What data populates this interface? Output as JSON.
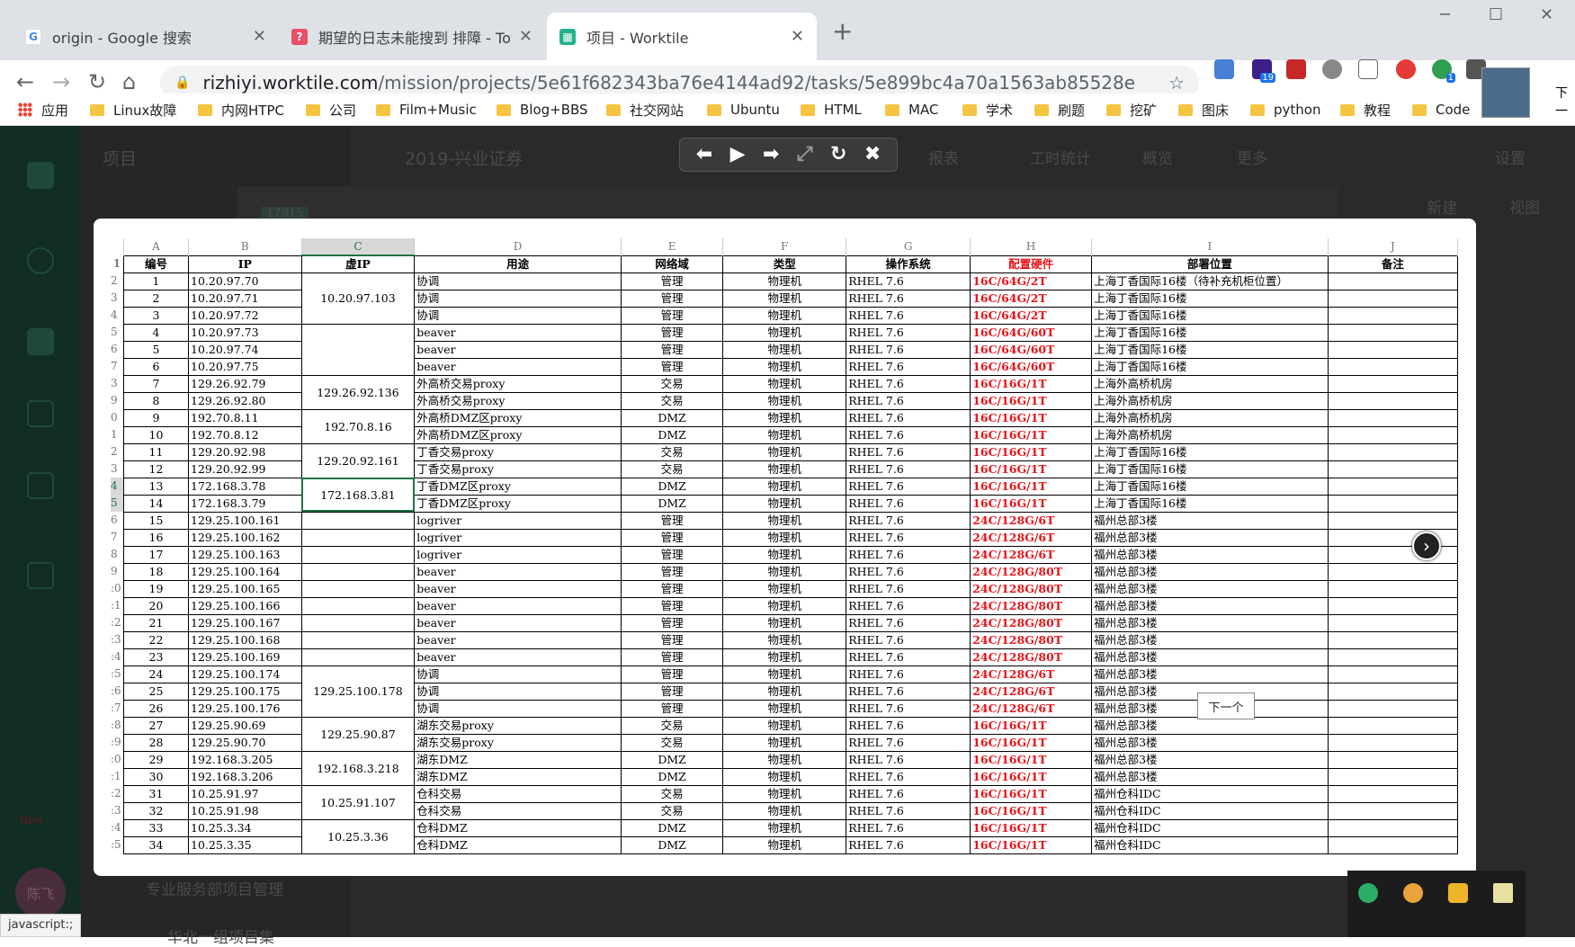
{
  "browser": {
    "tabs": [
      {
        "title": "origin - Google 搜索",
        "icon": "google-icon",
        "active": false
      },
      {
        "title": "期望的日志未能搜到 排障 - Tow",
        "icon": "tower-icon",
        "active": false
      },
      {
        "title": "项目 - Worktile",
        "icon": "worktile-icon",
        "active": true
      }
    ],
    "url_host": "rizhiyi.worktile.com",
    "url_path": "/mission/projects/5e61f682343ba76e4144ad92/tasks/5e899bc4a70a1563ab85528e",
    "extension_badges": [
      "19",
      "1"
    ],
    "bookmarks": [
      "应用",
      "Linux故障",
      "内网HTPC",
      "公司",
      "Film+Music",
      "Blog+BBS",
      "社交网站",
      "Ubuntu",
      "HTML",
      "MAC",
      "学术",
      "刷题",
      "挖矿",
      "图床",
      "python",
      "教程",
      "Code"
    ],
    "edge_text": "下一"
  },
  "app": {
    "sidebar_project_title": "项目",
    "project_name": "2019-兴业证券",
    "tab_count": "17915",
    "nav_items": [
      "报表",
      "工时统计",
      "概览",
      "更多"
    ],
    "settings": "设置",
    "new_button": "新建",
    "view_button": "视图",
    "new_badge": "New",
    "avatar_text": "陈飞",
    "group_name": "专业服务部项目管理",
    "sub_group": "华北一组项目集"
  },
  "viewer": {
    "tooltip": "下一个"
  },
  "sheet": {
    "columns": [
      "A",
      "B",
      "C",
      "D",
      "E",
      "F",
      "G",
      "H",
      "I",
      "J"
    ],
    "selected_column": "C",
    "row_numbers": [
      "1",
      "2",
      "3",
      "4",
      "5",
      "6",
      "7",
      "3",
      "9",
      "0",
      "1",
      "2",
      "3",
      "4",
      "5",
      "6",
      "7",
      "8",
      "9",
      ":0",
      ":1",
      ":2",
      ":3",
      ":4",
      ":5",
      ":6",
      ":7",
      ":8",
      ":9",
      ":0",
      ":1",
      ":2",
      ":3",
      ":4",
      ":5"
    ],
    "headers": [
      "编号",
      "IP",
      "虚IP",
      "用途",
      "网络域",
      "类型",
      "操作系统",
      "配置硬件",
      "部署位置",
      "备注"
    ],
    "rows": [
      [
        "1",
        "10.20.97.70",
        "协调",
        "管理",
        "物理机",
        "RHEL 7.6",
        "16C/64G/2T",
        "上海丁香国际16楼（待补充机柜位置）"
      ],
      [
        "2",
        "10.20.97.71",
        "协调",
        "管理",
        "物理机",
        "RHEL 7.6",
        "16C/64G/2T",
        "上海丁香国际16楼"
      ],
      [
        "3",
        "10.20.97.72",
        "协调",
        "管理",
        "物理机",
        "RHEL 7.6",
        "16C/64G/2T",
        "上海丁香国际16楼"
      ],
      [
        "4",
        "10.20.97.73",
        "beaver",
        "管理",
        "物理机",
        "RHEL 7.6",
        "16C/64G/60T",
        "上海丁香国际16楼"
      ],
      [
        "5",
        "10.20.97.74",
        "beaver",
        "管理",
        "物理机",
        "RHEL 7.6",
        "16C/64G/60T",
        "上海丁香国际16楼"
      ],
      [
        "6",
        "10.20.97.75",
        "beaver",
        "管理",
        "物理机",
        "RHEL 7.6",
        "16C/64G/60T",
        "上海丁香国际16楼"
      ],
      [
        "7",
        "129.26.92.79",
        "外高桥交易proxy",
        "交易",
        "物理机",
        "RHEL 7.6",
        "16C/16G/1T",
        "上海外高桥机房"
      ],
      [
        "8",
        "129.26.92.80",
        "外高桥交易proxy",
        "交易",
        "物理机",
        "RHEL 7.6",
        "16C/16G/1T",
        "上海外高桥机房"
      ],
      [
        "9",
        "192.70.8.11",
        "外高桥DMZ区proxy",
        "DMZ",
        "物理机",
        "RHEL 7.6",
        "16C/16G/1T",
        "上海外高桥机房"
      ],
      [
        "10",
        "192.70.8.12",
        "外高桥DMZ区proxy",
        "DMZ",
        "物理机",
        "RHEL 7.6",
        "16C/16G/1T",
        "上海外高桥机房"
      ],
      [
        "11",
        "129.20.92.98",
        "丁香交易proxy",
        "交易",
        "物理机",
        "RHEL 7.6",
        "16C/16G/1T",
        "上海丁香国际16楼"
      ],
      [
        "12",
        "129.20.92.99",
        "丁香交易proxy",
        "交易",
        "物理机",
        "RHEL 7.6",
        "16C/16G/1T",
        "上海丁香国际16楼"
      ],
      [
        "13",
        "172.168.3.78",
        "丁香DMZ区proxy",
        "DMZ",
        "物理机",
        "RHEL 7.6",
        "16C/16G/1T",
        "上海丁香国际16楼"
      ],
      [
        "14",
        "172.168.3.79",
        "丁香DMZ区proxy",
        "DMZ",
        "物理机",
        "RHEL 7.6",
        "16C/16G/1T",
        "上海丁香国际16楼"
      ],
      [
        "15",
        "129.25.100.161",
        "logriver",
        "管理",
        "物理机",
        "RHEL 7.6",
        "24C/128G/6T",
        "福州总部3楼"
      ],
      [
        "16",
        "129.25.100.162",
        "logriver",
        "管理",
        "物理机",
        "RHEL 7.6",
        "24C/128G/6T",
        "福州总部3楼"
      ],
      [
        "17",
        "129.25.100.163",
        "logriver",
        "管理",
        "物理机",
        "RHEL 7.6",
        "24C/128G/6T",
        "福州总部3楼"
      ],
      [
        "18",
        "129.25.100.164",
        "beaver",
        "管理",
        "物理机",
        "RHEL 7.6",
        "24C/128G/80T",
        "福州总部3楼"
      ],
      [
        "19",
        "129.25.100.165",
        "beaver",
        "管理",
        "物理机",
        "RHEL 7.6",
        "24C/128G/80T",
        "福州总部3楼"
      ],
      [
        "20",
        "129.25.100.166",
        "beaver",
        "管理",
        "物理机",
        "RHEL 7.6",
        "24C/128G/80T",
        "福州总部3楼"
      ],
      [
        "21",
        "129.25.100.167",
        "beaver",
        "管理",
        "物理机",
        "RHEL 7.6",
        "24C/128G/80T",
        "福州总部3楼"
      ],
      [
        "22",
        "129.25.100.168",
        "beaver",
        "管理",
        "物理机",
        "RHEL 7.6",
        "24C/128G/80T",
        "福州总部3楼"
      ],
      [
        "23",
        "129.25.100.169",
        "beaver",
        "管理",
        "物理机",
        "RHEL 7.6",
        "24C/128G/80T",
        "福州总部3楼"
      ],
      [
        "24",
        "129.25.100.174",
        "协调",
        "管理",
        "物理机",
        "RHEL 7.6",
        "24C/128G/6T",
        "福州总部3楼"
      ],
      [
        "25",
        "129.25.100.175",
        "协调",
        "管理",
        "物理机",
        "RHEL 7.6",
        "24C/128G/6T",
        "福州总部3楼"
      ],
      [
        "26",
        "129.25.100.176",
        "协调",
        "管理",
        "物理机",
        "RHEL 7.6",
        "24C/128G/6T",
        "福州总部3楼"
      ],
      [
        "27",
        "129.25.90.69",
        "湖东交易proxy",
        "交易",
        "物理机",
        "RHEL 7.6",
        "16C/16G/1T",
        "福州总部3楼"
      ],
      [
        "28",
        "129.25.90.70",
        "湖东交易proxy",
        "交易",
        "物理机",
        "RHEL 7.6",
        "16C/16G/1T",
        "福州总部3楼"
      ],
      [
        "29",
        "192.168.3.205",
        "湖东DMZ",
        "DMZ",
        "物理机",
        "RHEL 7.6",
        "16C/16G/1T",
        "福州总部3楼"
      ],
      [
        "30",
        "192.168.3.206",
        "湖东DMZ",
        "DMZ",
        "物理机",
        "RHEL 7.6",
        "16C/16G/1T",
        "福州总部3楼"
      ],
      [
        "31",
        "10.25.91.97",
        "仓科交易",
        "交易",
        "物理机",
        "RHEL 7.6",
        "16C/16G/1T",
        "福州仓科IDC"
      ],
      [
        "32",
        "10.25.91.98",
        "仓科交易",
        "交易",
        "物理机",
        "RHEL 7.6",
        "16C/16G/1T",
        "福州仓科IDC"
      ],
      [
        "33",
        "10.25.3.34",
        "仓科DMZ",
        "DMZ",
        "物理机",
        "RHEL 7.6",
        "16C/16G/1T",
        "福州仓科IDC"
      ],
      [
        "34",
        "10.25.3.35",
        "仓科DMZ",
        "DMZ",
        "物理机",
        "RHEL 7.6",
        "16C/16G/1T",
        "福州仓科IDC"
      ]
    ],
    "vip_merges": [
      {
        "start": 0,
        "span": 3,
        "value": "10.20.97.103"
      },
      {
        "start": 3,
        "span": 3,
        "value": ""
      },
      {
        "start": 6,
        "span": 2,
        "value": "129.26.92.136"
      },
      {
        "start": 8,
        "span": 2,
        "value": "192.70.8.16"
      },
      {
        "start": 10,
        "span": 2,
        "value": "129.20.92.161"
      },
      {
        "start": 12,
        "span": 2,
        "value": "172.168.3.81"
      },
      {
        "start": 14,
        "span": 1,
        "value": ""
      },
      {
        "start": 15,
        "span": 1,
        "value": ""
      },
      {
        "start": 16,
        "span": 1,
        "value": ""
      },
      {
        "start": 17,
        "span": 1,
        "value": ""
      },
      {
        "start": 18,
        "span": 1,
        "value": ""
      },
      {
        "start": 19,
        "span": 1,
        "value": ""
      },
      {
        "start": 20,
        "span": 1,
        "value": ""
      },
      {
        "start": 21,
        "span": 1,
        "value": ""
      },
      {
        "start": 22,
        "span": 1,
        "value": ""
      },
      {
        "start": 23,
        "span": 3,
        "value": "129.25.100.178"
      },
      {
        "start": 26,
        "span": 2,
        "value": "129.25.90.87"
      },
      {
        "start": 28,
        "span": 2,
        "value": "192.168.3.218"
      },
      {
        "start": 30,
        "span": 2,
        "value": "10.25.91.107"
      },
      {
        "start": 32,
        "span": 2,
        "value": "10.25.3.36"
      }
    ]
  },
  "status_bar": "javascript:;"
}
